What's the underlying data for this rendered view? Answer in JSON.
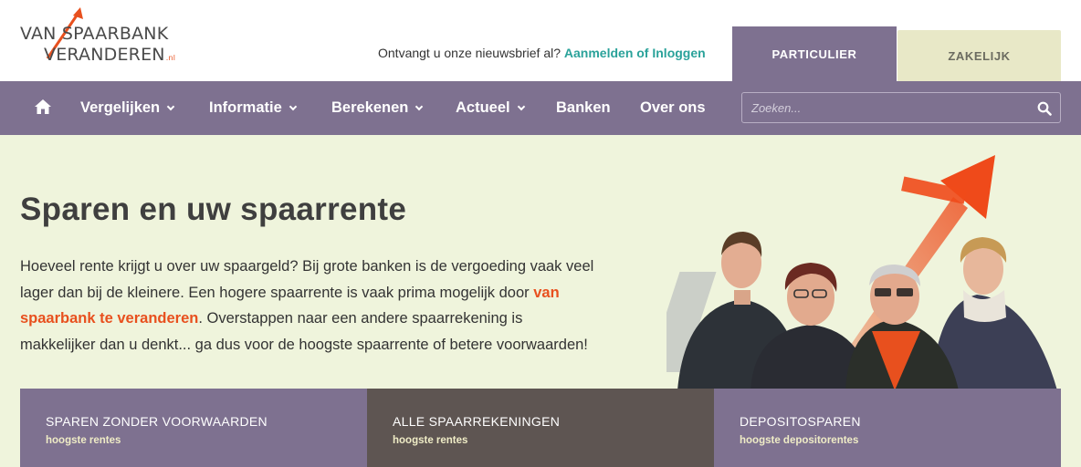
{
  "brand": {
    "line1": "VAN SPAARBANK",
    "line2": "VERANDEREN",
    "suffix": ".nl",
    "accent_color": "#e8501e"
  },
  "header": {
    "newsletter_text": "Ontvangt u onze nieuwsbrief al?",
    "newsletter_link": "Aanmelden of Inloggen",
    "tabs": [
      {
        "label": "PARTICULIER",
        "active": true
      },
      {
        "label": "ZAKELIJK",
        "active": false
      }
    ]
  },
  "nav": {
    "home_icon": "home-icon",
    "items": [
      {
        "label": "Vergelijken",
        "dropdown": true
      },
      {
        "label": "Informatie",
        "dropdown": true
      },
      {
        "label": "Berekenen",
        "dropdown": true
      },
      {
        "label": "Actueel",
        "dropdown": true
      },
      {
        "label": "Banken",
        "dropdown": false
      },
      {
        "label": "Over ons",
        "dropdown": false
      }
    ],
    "search_placeholder": "Zoeken...",
    "color": "#7e7190"
  },
  "hero": {
    "title": "Sparen en uw spaarrente",
    "text_before": "Hoeveel rente krijgt u over uw spaargeld? Bij grote banken is de vergoeding vaak veel lager dan bij de kleinere. Een hogere spaarrente is vaak prima mogelijk door ",
    "link": "van spaarbank te veranderen",
    "text_after": ". Overstappen naar een andere spaarrekening is makkelijker dan u denkt... ga dus voor de hoogste spaarrente of betere voorwaarden!",
    "background": "#eff4dc"
  },
  "cards": [
    {
      "title": "SPAREN ZONDER VOORWAARDEN",
      "subtitle": "hoogste rentes"
    },
    {
      "title": "ALLE SPAARREKENINGEN",
      "subtitle": "hoogste rentes"
    },
    {
      "title": "DEPOSITOSPAREN",
      "subtitle": "hoogste depositorentes"
    }
  ]
}
